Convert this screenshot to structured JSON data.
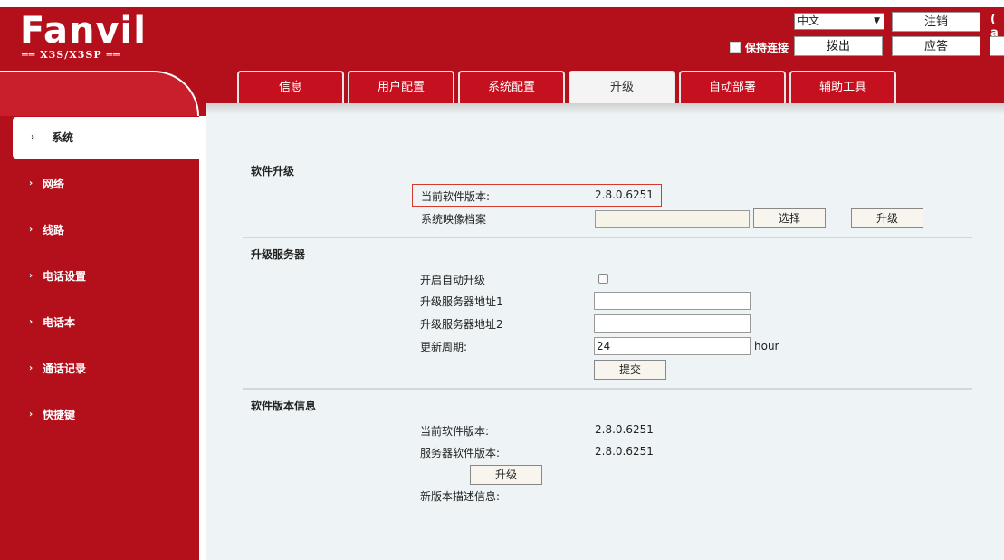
{
  "header": {
    "brand_name": "Fanvil",
    "brand_model": "X3S/X3SP",
    "language": "中文",
    "keep_alive_label": "保持连接",
    "logout_label": "注销",
    "hangup_label": "拨出",
    "answer_label": "应答",
    "paren_text": "( a"
  },
  "tabs": [
    {
      "label": "信息"
    },
    {
      "label": "用户配置"
    },
    {
      "label": "系统配置"
    },
    {
      "label": "升级"
    },
    {
      "label": "自动部署"
    },
    {
      "label": "辅助工具"
    }
  ],
  "sidebar": {
    "items": [
      {
        "label": "系统"
      },
      {
        "label": "网络"
      },
      {
        "label": "线路"
      },
      {
        "label": "电话设置"
      },
      {
        "label": "电话本"
      },
      {
        "label": "通话记录"
      },
      {
        "label": "快捷键"
      }
    ]
  },
  "software_upgrade": {
    "title": "软件升级",
    "current_version_label": "当前软件版本:",
    "current_version": "2.8.0.6251",
    "image_file_label": "系统映像档案",
    "choose_button": "选择",
    "upgrade_button": "升级"
  },
  "upgrade_server": {
    "title": "升级服务器",
    "auto_upgrade_label": "开启自动升级",
    "server1_label": "升级服务器地址1",
    "server2_label": "升级服务器地址2",
    "period_label": "更新周期:",
    "period_value": "24",
    "period_unit": "hour",
    "submit_button": "提交"
  },
  "version_info": {
    "title": "软件版本信息",
    "current_label": "当前软件版本:",
    "current_value": "2.8.0.6251",
    "server_label": "服务器软件版本:",
    "server_value": "2.8.0.6251",
    "upgrade_button": "升级",
    "description_label": "新版本描述信息:"
  }
}
